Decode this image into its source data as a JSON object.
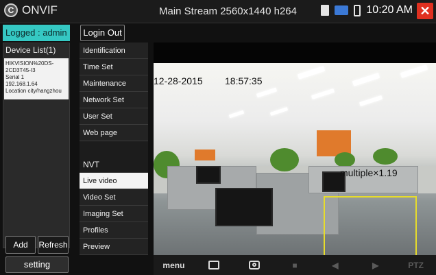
{
  "header": {
    "app_title": "ONVIF",
    "stream_title": "Main Stream 2560x1440 h264",
    "clock": "10:20 AM",
    "close_glyph": "✕"
  },
  "login": {
    "status": "Logged : admin",
    "logout_button": "Login Out"
  },
  "device_list": {
    "title": "Device List(1)",
    "devices": [
      {
        "name": "HIKVISION%20DS-2CD3T45-I3",
        "serial": "Serial 1",
        "ip": "192.168.1.64",
        "location": "Location city/hangzhou"
      }
    ]
  },
  "buttons": {
    "add": "Add",
    "refresh": "Refresh",
    "setting": "setting"
  },
  "menu": {
    "items": [
      {
        "label": "Identification"
      },
      {
        "label": "Time Set"
      },
      {
        "label": "Maintenance"
      },
      {
        "label": "Network Set"
      },
      {
        "label": "User Set"
      },
      {
        "label": "Web page"
      }
    ],
    "nvt_header": "NVT",
    "nvt_items": [
      {
        "label": "Live video",
        "active": true
      },
      {
        "label": "Video Set"
      },
      {
        "label": "Imaging Set"
      },
      {
        "label": "Profiles"
      },
      {
        "label": "Preview"
      }
    ]
  },
  "video": {
    "date": "12-28-2015",
    "time": "18:57:35",
    "overlay": "multiple×1.19"
  },
  "toolbar": {
    "menu_label": "menu",
    "ptz_label": "PTZ"
  },
  "colors": {
    "logged_bg": "#35c8c3",
    "close_bg": "#e03020",
    "roi_border": "#e7dc2b",
    "active_menu_bg": "#f4f4f4"
  }
}
